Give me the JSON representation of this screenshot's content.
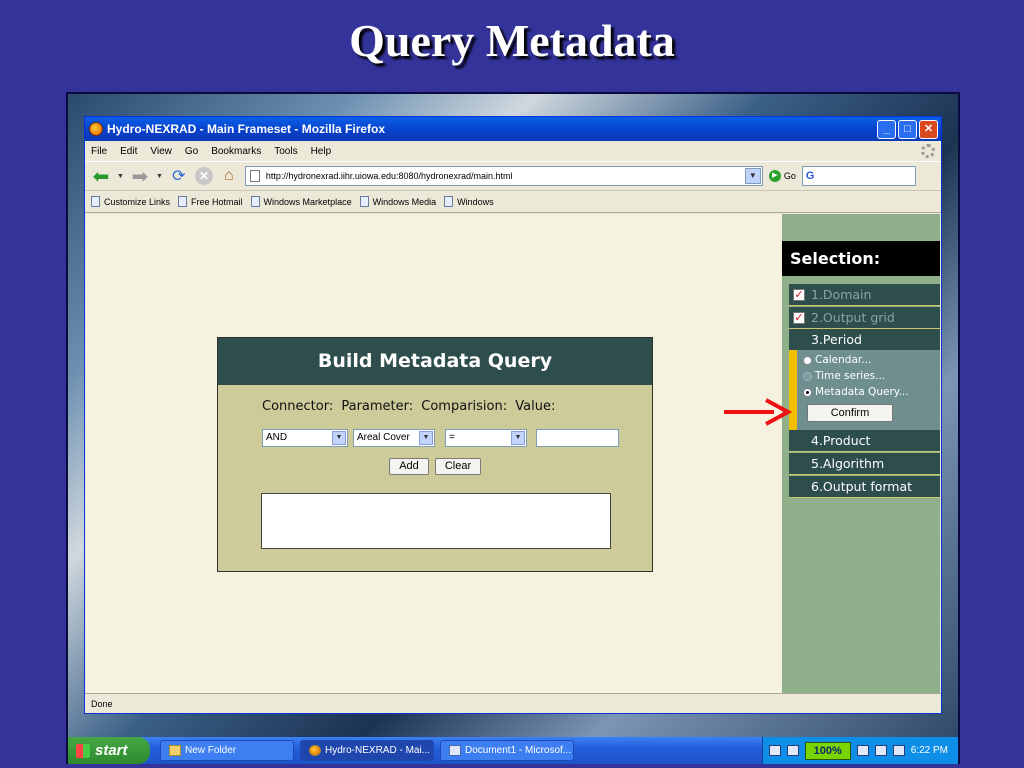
{
  "slide": {
    "title": "Query Metadata"
  },
  "window": {
    "title": "Hydro-NEXRAD - Main Frameset - Mozilla Firefox",
    "buttons": {
      "minimize": "_",
      "maximize": "□",
      "close": "✕"
    }
  },
  "menu": [
    "File",
    "Edit",
    "View",
    "Go",
    "Bookmarks",
    "Tools",
    "Help"
  ],
  "nav": {
    "url": "http://hydronexrad.iihr.uiowa.edu:8080/hydronexrad/main.html",
    "go_label": "Go",
    "search_value": "G"
  },
  "bookmarks": [
    "Customize Links",
    "Free Hotmail",
    "Windows Marketplace",
    "Windows Media",
    "Windows"
  ],
  "query": {
    "title": "Build Metadata Query",
    "headers": {
      "connector": "Connector:",
      "parameter": "Parameter:",
      "comparison": "Comparision:",
      "value": "Value:"
    },
    "connector_value": "AND",
    "parameter_value": "Areal Cover",
    "comparison_value": "=",
    "add_label": "Add",
    "clear_label": "Clear"
  },
  "selection": {
    "title": "Selection:",
    "steps": [
      "1.Domain",
      "2.Output grid",
      "3.Period",
      "4.Product",
      "5.Algorithm",
      "6.Output format"
    ],
    "options": [
      "Calendar...",
      "Time series...",
      "Metadata Query..."
    ],
    "confirm_label": "Confirm"
  },
  "status": "Done",
  "taskbar": {
    "start": "start",
    "tasks": [
      "New Folder",
      "Hydro-NEXRAD - Mai...",
      "Document1 - Microsof..."
    ],
    "zoom": "100%",
    "time": "6:22 PM"
  },
  "colors": {
    "panel_head": "#2e4d4d",
    "panel_body": "#cdcb9a",
    "sidebar": "#8fb08a",
    "accent": "#f0c000",
    "arrow": "#ee1111"
  }
}
